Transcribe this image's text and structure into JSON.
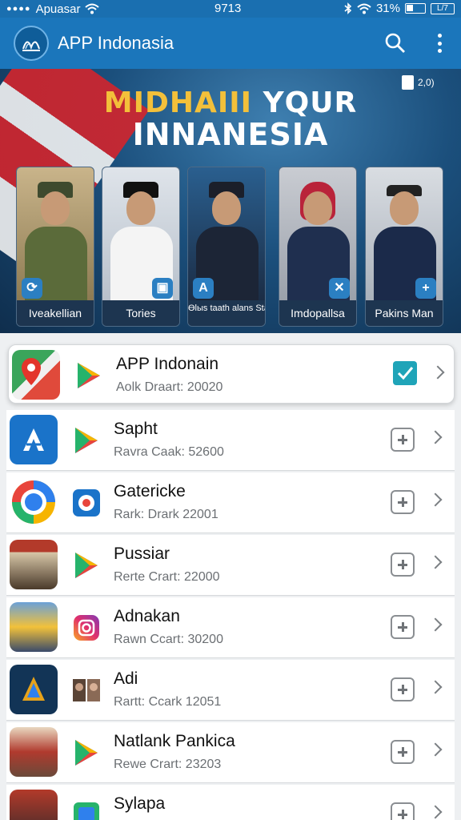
{
  "status_bar": {
    "dots": "●●●●",
    "carrier": "Apuasar",
    "time": "9713",
    "battery": "31%",
    "charge_label": "L/7"
  },
  "app_bar": {
    "title": "APP Indonasia",
    "icons": [
      "logo-icon",
      "search-icon",
      "more-vert-icon"
    ]
  },
  "banner": {
    "headline_gold": "MIDHAIII",
    "headline_white_1": "YQUR",
    "headline_2": "INNANESIA",
    "badge": "2,0)",
    "cards": [
      {
        "label": "Ivеakellian",
        "icon": "⟳"
      },
      {
        "label": "Tories",
        "icon": "▣"
      },
      {
        "label": "Өlыs tааth alans Stasсоllom",
        "icon": "A"
      },
      {
        "label": "Imdopallsa",
        "icon": "✕"
      },
      {
        "label": "Pakins Man",
        "icon": "+"
      }
    ]
  },
  "apps": [
    {
      "name": "APP Indonain",
      "sub": "Aolk Draart: 20020",
      "state": "checked"
    },
    {
      "name": "Sapht",
      "sub": "Ravra Caak: 52600",
      "state": "add"
    },
    {
      "name": "Gatericke",
      "sub": "Rark: Drark 22001",
      "state": "add"
    },
    {
      "name": "Pussiar",
      "sub": "Rerte Crart: 22000",
      "state": "add"
    },
    {
      "name": "Adnakan",
      "sub": "Rawn Ccart: 30200",
      "state": "add"
    },
    {
      "name": "Adi",
      "sub": "Rartt: Ccark 12051",
      "state": "add"
    },
    {
      "name": "Natlank Pankica",
      "sub": "Rewe Crart: 23203",
      "state": "add"
    },
    {
      "name": "Sylapa",
      "sub": "",
      "state": "add"
    }
  ],
  "colors": {
    "primary": "#1b76bb",
    "headline_gold": "#f3c03a",
    "check": "#1fa4b8"
  }
}
